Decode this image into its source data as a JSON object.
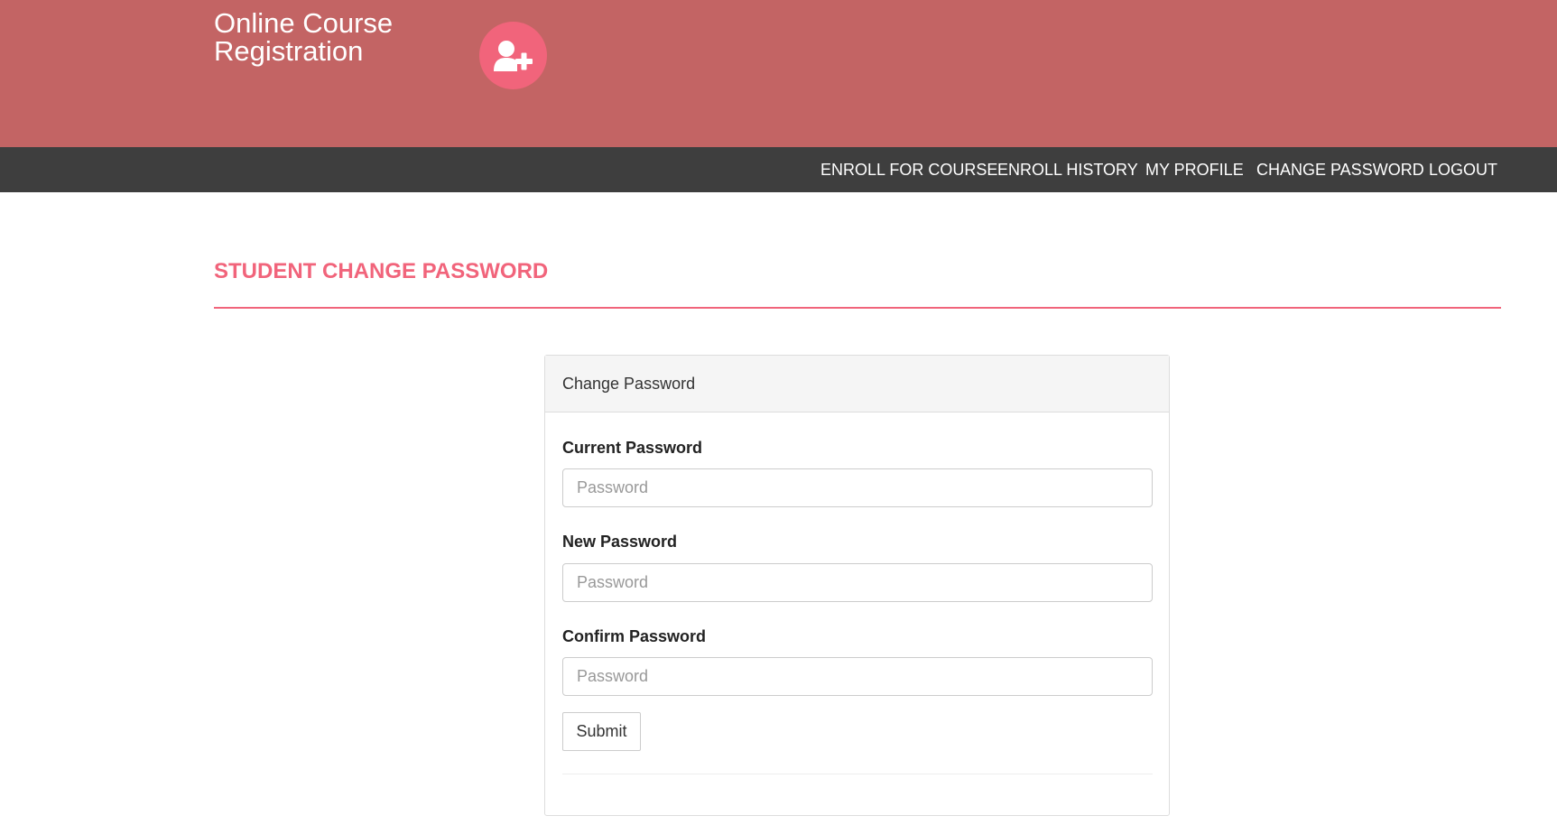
{
  "header": {
    "brand": "Online Course Registration",
    "icon": "user-plus-icon",
    "background_color": "#c36464",
    "icon_circle_color": "#f1647b"
  },
  "nav": {
    "background_color": "#3e3e3e",
    "items": [
      {
        "label": "ENROLL FOR COURSE"
      },
      {
        "label": "ENROLL HISTORY"
      },
      {
        "label": "MY PROFILE"
      },
      {
        "label": "CHANGE PASSWORD"
      },
      {
        "label": "LOGOUT"
      }
    ]
  },
  "page": {
    "title": "STUDENT CHANGE PASSWORD",
    "accent_color": "#f1647b"
  },
  "form": {
    "heading": "Change Password",
    "fields": [
      {
        "label": "Current Password",
        "placeholder": "Password",
        "value": ""
      },
      {
        "label": "New Password",
        "placeholder": "Password",
        "value": ""
      },
      {
        "label": "Confirm Password",
        "placeholder": "Password",
        "value": ""
      }
    ],
    "submit_label": "Submit"
  }
}
